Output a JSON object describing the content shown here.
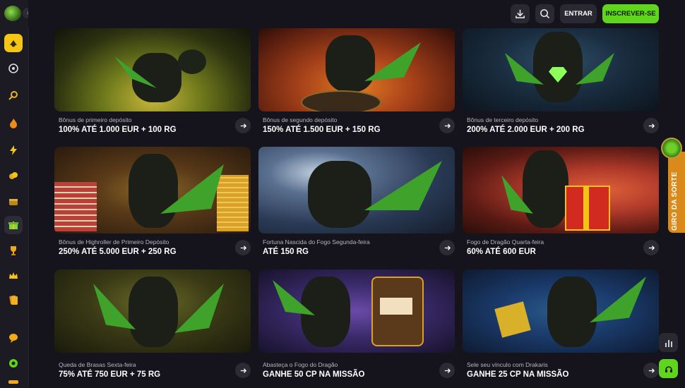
{
  "header": {
    "login_label": "ENTRAR",
    "signup_label": "INSCREVER-SE"
  },
  "side_tab": {
    "label": "GIRO DA SORTE"
  },
  "promos": [
    {
      "subtitle": "Bônus de primeiro depósito",
      "title": "100% ATÉ 1.000 EUR + 100 RG"
    },
    {
      "subtitle": "Bônus de segundo depósito",
      "title": "150% ATÉ 1.500 EUR + 150 RG"
    },
    {
      "subtitle": "Bônus de terceiro depósito",
      "title": "200% ATÉ 2.000 EUR + 200 RG"
    },
    {
      "subtitle": "Bônus de Highroller de Primeiro Depósito",
      "title": "250% ATÉ 5.000 EUR + 250 RG"
    },
    {
      "subtitle": "Fortuna Nascida do Fogo Segunda-feira",
      "title": "ATÉ 150 RG"
    },
    {
      "subtitle": "Fogo de Dragão Quarta-feira",
      "title": "60% ATÉ 600 EUR"
    },
    {
      "subtitle": "Queda de Brasas Sexta-feira",
      "title": "75% ATÉ 750 EUR + 75 RG"
    },
    {
      "subtitle": "Abasteça o Fogo do Dragão",
      "title": "GANHE 50 CP NA MISSÃO"
    },
    {
      "subtitle": "Sele seu vínculo com Drakaris",
      "title": "GANHE 25 CP NA MISSÃO"
    }
  ],
  "sidebar_icons": [
    "casino-chip-icon",
    "roulette-icon",
    "search-icon",
    "fire-icon",
    "lightning-icon",
    "coins-icon",
    "treasure-icon",
    "gift-icon",
    "trophy-icon",
    "crown-icon",
    "cards-icon",
    "chat-icon",
    "support-icon",
    "language-icon"
  ],
  "colors": {
    "accent_green": "#5fd61b",
    "active_yellow": "#f4c516",
    "lucky_orange": "#d98a1a"
  }
}
